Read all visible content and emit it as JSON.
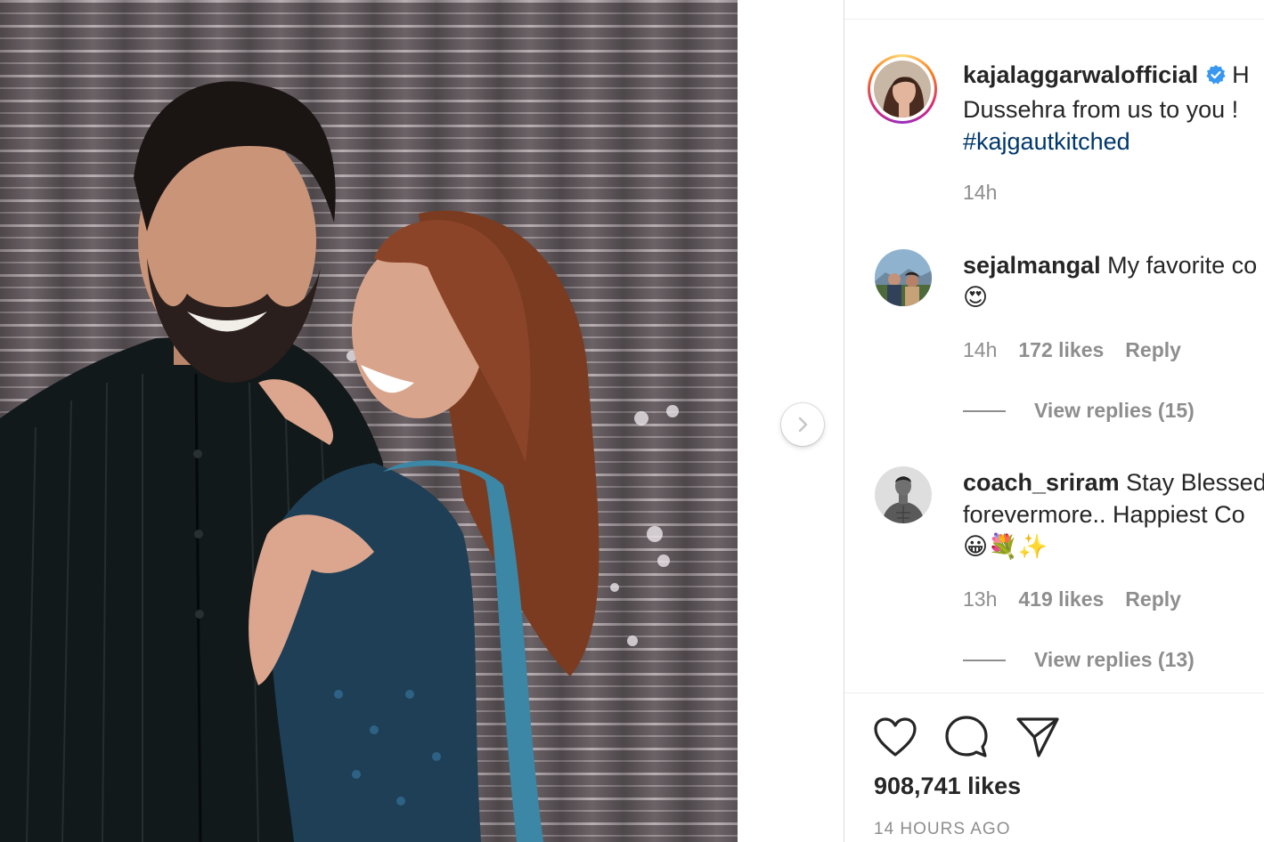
{
  "post": {
    "caption_username": "kajalaggarwalofficial",
    "caption_line1": "H",
    "caption_line2": "Dussehra from us to you !",
    "caption_hashtag": "#kajgautkitched",
    "caption_time": "14h",
    "likes": "908,741 likes",
    "time_ago": "14 HOURS AGO"
  },
  "comments": [
    {
      "username": "sejalmangal",
      "text_line1": "My favorite co",
      "text_line2": "😍",
      "time": "14h",
      "likes": "172 likes",
      "reply": "Reply",
      "view_replies": "View replies (15)"
    },
    {
      "username": "coach_sriram",
      "text_line1": "Stay Blessed",
      "text_line2": "forevermore.. Happiest Co",
      "text_line3": "😀💐✨",
      "time": "13h",
      "likes": "419 likes",
      "reply": "Reply",
      "view_replies": "View replies (13)"
    }
  ],
  "icons": {
    "verified": "verified-badge-icon",
    "next": "chevron-right-icon",
    "like": "heart-icon",
    "comment": "comment-icon",
    "share": "paper-plane-icon"
  },
  "colors": {
    "text": "#262626",
    "muted": "#8e8e8e",
    "hashtag": "#00376b",
    "verified": "#3897f0"
  }
}
